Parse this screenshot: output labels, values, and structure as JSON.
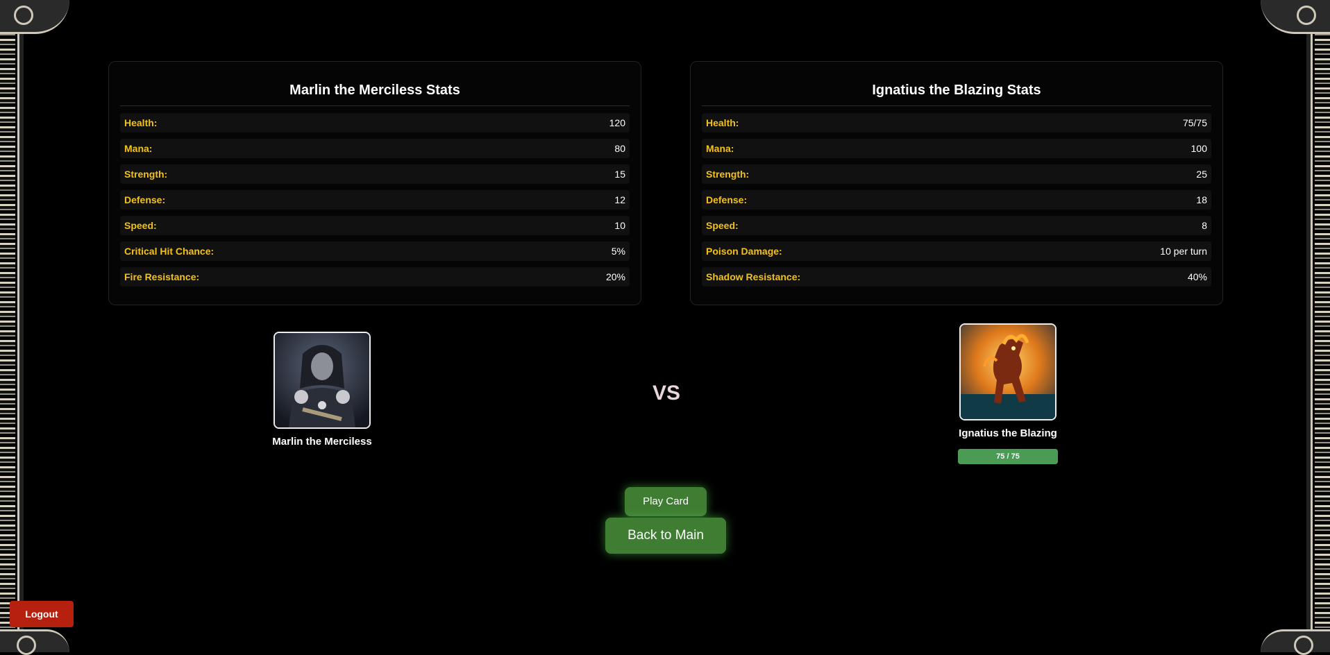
{
  "player": {
    "stats_title": "Marlin the Merciless Stats",
    "stats": [
      {
        "label": "Health:",
        "value": "120"
      },
      {
        "label": "Mana:",
        "value": "80"
      },
      {
        "label": "Strength:",
        "value": "15"
      },
      {
        "label": "Defense:",
        "value": "12"
      },
      {
        "label": "Speed:",
        "value": "10"
      },
      {
        "label": "Critical Hit Chance:",
        "value": "5%"
      },
      {
        "label": "Fire Resistance:",
        "value": "20%"
      }
    ],
    "name": "Marlin the Merciless"
  },
  "opponent": {
    "stats_title": "Ignatius the Blazing Stats",
    "stats": [
      {
        "label": "Health:",
        "value": "75/75"
      },
      {
        "label": "Mana:",
        "value": "100"
      },
      {
        "label": "Strength:",
        "value": "25"
      },
      {
        "label": "Defense:",
        "value": "18"
      },
      {
        "label": "Speed:",
        "value": "8"
      },
      {
        "label": "Poison Damage:",
        "value": "10 per turn"
      },
      {
        "label": "Shadow Resistance:",
        "value": "40%"
      }
    ],
    "name": "Ignatius the Blazing",
    "health_text": "75 / 75",
    "health_fraction": 1.0
  },
  "vs_label": "VS",
  "buttons": {
    "play_card": "Play Card",
    "back_to_main": "Back to Main",
    "logout": "Logout"
  },
  "colors": {
    "stat_label": "#f2c21a",
    "button_green": "#3f7d32",
    "logout_red": "#b5200f",
    "health_bar": "#4a9c55"
  }
}
